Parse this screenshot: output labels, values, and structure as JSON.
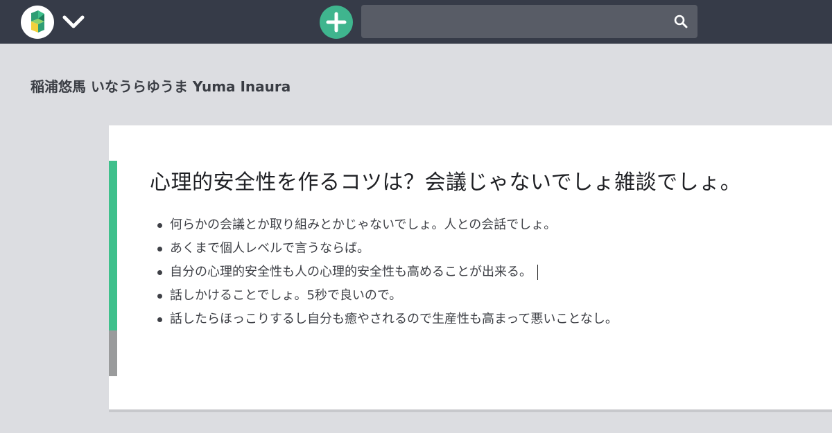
{
  "topbar": {
    "logo_icon": "app-logo-icon",
    "menu_icon": "chevron-down-icon",
    "add_icon": "plus-icon",
    "search": {
      "value": "",
      "placeholder": "",
      "icon": "search-icon"
    },
    "colors": {
      "bar": "#363b48",
      "add": "#3fb58e",
      "search": "#585c66"
    }
  },
  "page": {
    "user_name": "稲浦悠馬 いなうらゆうま Yuma Inaura"
  },
  "card": {
    "title": "心理的安全性を作るコツは？会議じゃないでしょ雑談でしょ。",
    "bullets": [
      "何らかの会議とか取り組みとかじゃないでしょ。人との会話でしょ。",
      "あくまで個人レベルで言うならば。",
      "自分の心理的安全性も人の心理的安全性も高めることが出来る。",
      "話しかけることでしょ。5秒で良いので。",
      "話したらほっこりするし自分も癒やされるので生産性も高まって悪いことなし。"
    ],
    "colors": {
      "accent": "#3fc08c",
      "accent_secondary": "#9a9b9c"
    }
  }
}
